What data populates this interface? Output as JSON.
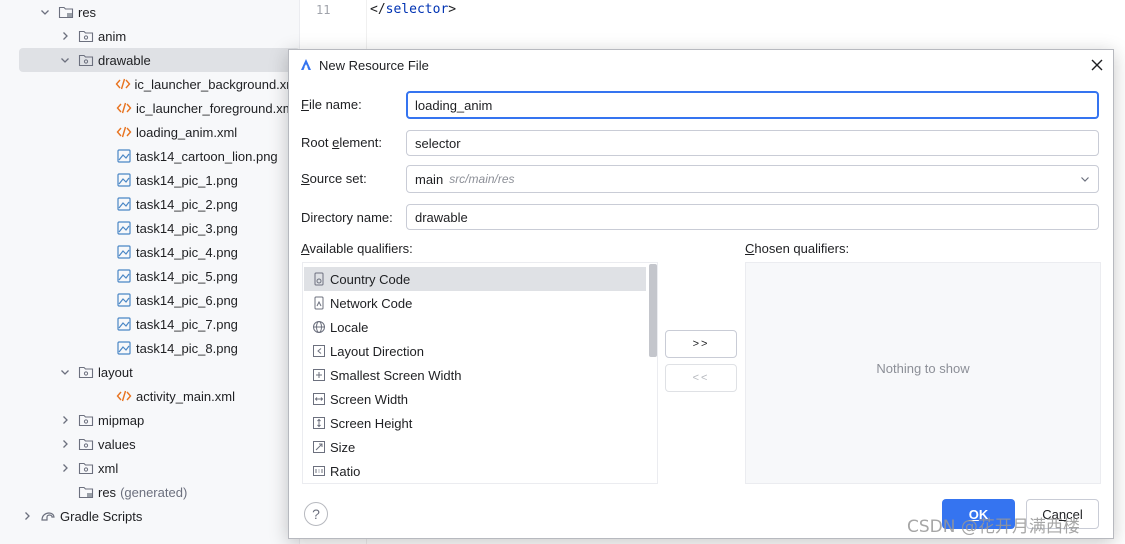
{
  "tree": {
    "items": [
      {
        "label": "res",
        "type": "resfolder",
        "expanded": true,
        "level": 0
      },
      {
        "label": "anim",
        "type": "folder",
        "expanded": false,
        "level": 1
      },
      {
        "label": "drawable",
        "type": "folder",
        "expanded": true,
        "level": 1
      },
      {
        "label": "ic_launcher_background.xml",
        "type": "xml",
        "level": 2
      },
      {
        "label": "ic_launcher_foreground.xml",
        "type": "xml",
        "level": 2
      },
      {
        "label": "loading_anim.xml",
        "type": "xml",
        "level": 2
      },
      {
        "label": "task14_cartoon_lion.png",
        "type": "image",
        "level": 2
      },
      {
        "label": "task14_pic_1.png",
        "type": "image",
        "level": 2
      },
      {
        "label": "task14_pic_2.png",
        "type": "image",
        "level": 2
      },
      {
        "label": "task14_pic_3.png",
        "type": "image",
        "level": 2
      },
      {
        "label": "task14_pic_4.png",
        "type": "image",
        "level": 2
      },
      {
        "label": "task14_pic_5.png",
        "type": "image",
        "level": 2
      },
      {
        "label": "task14_pic_6.png",
        "type": "image",
        "level": 2
      },
      {
        "label": "task14_pic_7.png",
        "type": "image",
        "level": 2
      },
      {
        "label": "task14_pic_8.png",
        "type": "image",
        "level": 2
      },
      {
        "label": "layout",
        "type": "folder",
        "expanded": true,
        "level": 1
      },
      {
        "label": "activity_main.xml",
        "type": "xml",
        "level": 2
      },
      {
        "label": "mipmap",
        "type": "folder",
        "expanded": false,
        "level": 1
      },
      {
        "label": "values",
        "type": "folder",
        "expanded": false,
        "level": 1
      },
      {
        "label": "xml",
        "type": "folder",
        "expanded": false,
        "level": 1
      },
      {
        "label": "res",
        "suffix": "(generated)",
        "type": "resfolder",
        "level": 1
      },
      {
        "label": "Gradle Scripts",
        "type": "gradle",
        "expanded": false,
        "level": -1
      }
    ]
  },
  "editor": {
    "line_number": "11",
    "code_open": "</",
    "code_tag": "selector",
    "code_close": ">"
  },
  "dialog": {
    "title": "New Resource File",
    "file_name_label_pre": "F",
    "file_name_label_post": "ile name:",
    "file_name_value": "loading_anim",
    "root_element_label_pre": "Root ",
    "root_element_label_u": "e",
    "root_element_label_post": "lement:",
    "root_element_value": "selector",
    "source_set_label_pre": "S",
    "source_set_label_post": "ource set:",
    "source_set_main": "main",
    "source_set_path": "src/main/res",
    "directory_label": "Directory name:",
    "directory_value": "drawable",
    "available_label_pre": "A",
    "available_label_post": "vailable qualifiers:",
    "chosen_label_pre": "C",
    "chosen_label_post": "hosen qualifiers:",
    "qualifiers": [
      {
        "label": "Country Code",
        "icon": "country-code-icon"
      },
      {
        "label": "Network Code",
        "icon": "network-code-icon"
      },
      {
        "label": "Locale",
        "icon": "globe-icon"
      },
      {
        "label": "Layout Direction",
        "icon": "layout-direction-icon"
      },
      {
        "label": "Smallest Screen Width",
        "icon": "smallest-width-icon"
      },
      {
        "label": "Screen Width",
        "icon": "screen-width-icon"
      },
      {
        "label": "Screen Height",
        "icon": "screen-height-icon"
      },
      {
        "label": "Size",
        "icon": "size-icon"
      },
      {
        "label": "Ratio",
        "icon": "ratio-icon"
      }
    ],
    "add_button": ">>",
    "remove_button": "<<",
    "chosen_empty": "Nothing to show",
    "help_label": "?",
    "ok_label_u": "O",
    "ok_label_post": "K",
    "cancel_label_pre": "Ca",
    "cancel_label_u": "n",
    "cancel_label_post": "cel"
  },
  "watermark": "CSDN @花开月满西楼",
  "colors": {
    "accent": "#3574f0",
    "xml_icon": "#e8731f",
    "image_icon": "#4a86c5",
    "selection": "#dfe1e5"
  }
}
